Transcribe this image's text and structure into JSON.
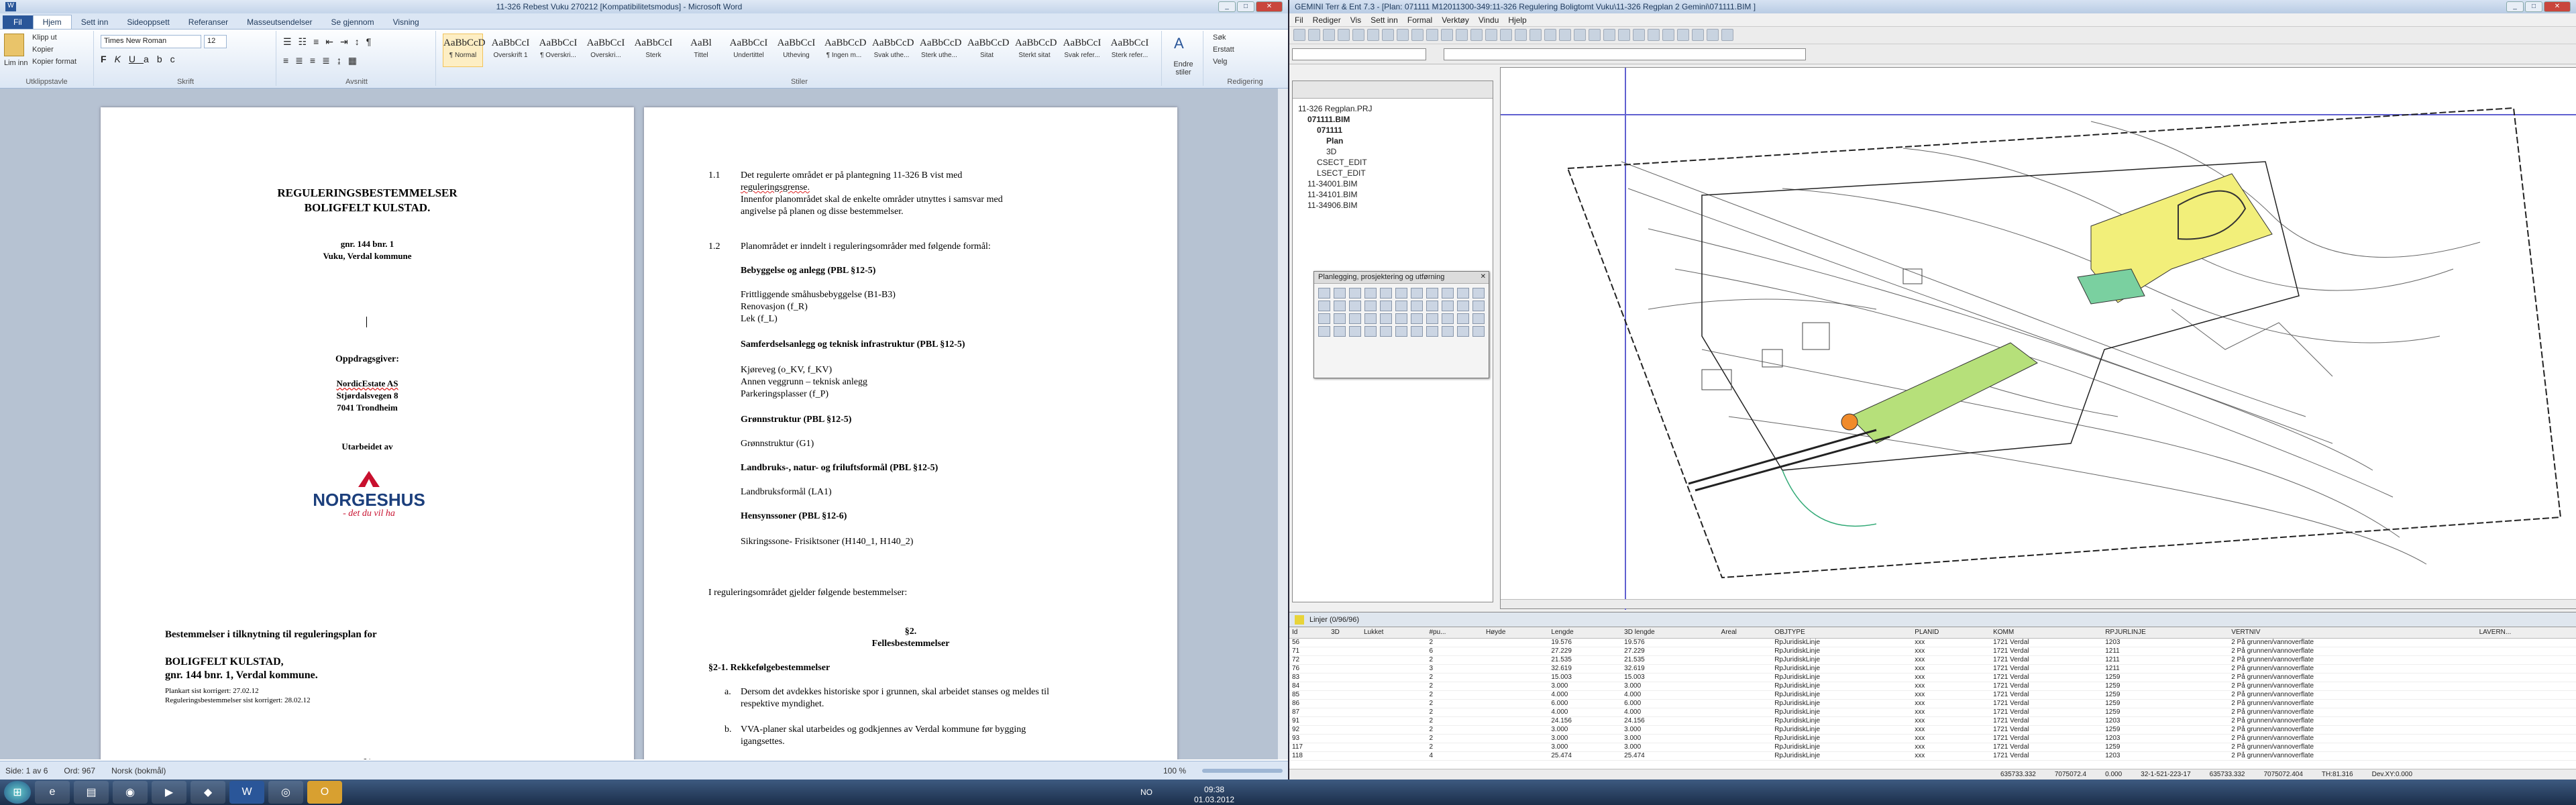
{
  "word": {
    "title": "11-326 Rebest Vuku 270212 [Kompatibilitetsmodus] - Microsoft Word",
    "tabs": [
      "Fil",
      "Hjem",
      "Sett inn",
      "Sideoppsett",
      "Referanser",
      "Masseutsendelser",
      "Se gjennom",
      "Visning"
    ],
    "clipboard": {
      "paste": "Lim inn",
      "cut": "Klipp ut",
      "copy": "Kopier",
      "format_painter": "Kopier format",
      "label": "Utklippstavle"
    },
    "font": {
      "name": "Times New Roman",
      "size": "12",
      "label": "Skrift"
    },
    "paragraph_label": "Avsnitt",
    "styles_label": "Stiler",
    "styles": [
      {
        "sample": "AaBbCcD",
        "name": "¶ Normal"
      },
      {
        "sample": "AaBbCcI",
        "name": "Overskrift 1"
      },
      {
        "sample": "AaBbCcI",
        "name": "¶ Overskri..."
      },
      {
        "sample": "AaBbCcI",
        "name": "Overskri..."
      },
      {
        "sample": "AaBbCcI",
        "name": "Sterk"
      },
      {
        "sample": "AaBl",
        "name": "Tittel"
      },
      {
        "sample": "AaBbCcI",
        "name": "Undertittel"
      },
      {
        "sample": "AaBbCcI",
        "name": "Utheving"
      },
      {
        "sample": "AaBbCcD",
        "name": "¶ Ingen m..."
      },
      {
        "sample": "AaBbCcD",
        "name": "Svak uthe..."
      },
      {
        "sample": "AaBbCcD",
        "name": "Sterk uthe..."
      },
      {
        "sample": "AaBbCcD",
        "name": "Sitat"
      },
      {
        "sample": "AaBbCcD",
        "name": "Sterkt sitat"
      },
      {
        "sample": "AaBbCcI",
        "name": "Svak refer..."
      },
      {
        "sample": "AaBbCcI",
        "name": "Sterk refer..."
      }
    ],
    "change_styles": "Endre stiler",
    "editing": {
      "find": "Søk",
      "replace": "Erstatt",
      "select": "Velg",
      "label": "Redigering"
    },
    "page1": {
      "title1": "REGULERINGSBESTEMMELSER",
      "title2": "BOLIGFELT KULSTAD.",
      "gnr": "gnr. 144 bnr. 1",
      "loc": "Vuku, Verdal kommune",
      "client_label": "Oppdragsgiver:",
      "client1": "NordicEstate AS",
      "client2": "Stjørdalsvegen 8",
      "client3": "7041 Trondheim",
      "made_by": "Utarbeidet av",
      "logo_text": "NORGESHUS",
      "logo_tag": "- det du vil ha",
      "b1": "Bestemmelser i tilknytning til reguleringsplan for",
      "b2": "BOLIGFELT KULSTAD,",
      "b3": "gnr. 144 bnr. 1, Verdal kommune.",
      "d1": "Plankart sist korrigert:  27.02.12",
      "d2": "Reguleringsbestemmelser sist korrigert:  28.02.12",
      "footer": "§1"
    },
    "page2": {
      "n11": "1.1",
      "l1": "Det regulerte området er på plantegning 11-326 B vist med",
      "l2": "reguleringsgrense.",
      "l3": "Innenfor planområdet skal de enkelte områder utnyttes i samsvar med",
      "l4": "angivelse på planen og disse bestemmelser.",
      "n12": "1.2",
      "l5": "Planområdet er inndelt i reguleringsområder med følgende formål:",
      "h1": "Bebyggelse og anlegg (PBL §12-5)",
      "l6": "Frittliggende småhusbebyggelse (B1-B3)",
      "l7": "Renovasjon (f_R)",
      "l8": "Lek (f_L)",
      "h2": "Samferdselsanlegg og teknisk infrastruktur (PBL §12-5)",
      "l9": "Kjøreveg (o_KV, f_KV)",
      "l10": "Annen veggrunn – teknisk anlegg",
      "l11": "Parkeringsplasser (f_P)",
      "h3": "Grønnstruktur (PBL §12-5)",
      "l12": "Grønnstruktur (G1)",
      "h4": "Landbruks-, natur- og friluftsformål (PBL §12-5)",
      "l13": "Landbruksformål (LA1)",
      "h5": "Hensynssoner (PBL §12-6)",
      "l14": "Sikringssone- Frisiktsoner (H140_1, H140_2)",
      "l15": "I reguleringsområdet gjelder følgende bestemmelser:",
      "p2": "§2.",
      "fb": "Fellesbestemmelser",
      "s21": "§2-1. Rekkefølgebestemmelser",
      "a": "a.",
      "la1": "Dersom det avdekkes historiske spor i grunnen, skal arbeidet stanses og meldes til",
      "la2": "respektive myndighet.",
      "b": "b.",
      "lb1": "VVA-planer skal utarbeides og godkjennes av Verdal kommune før bygging",
      "lb2": "igangsettes."
    },
    "status": {
      "page": "Side: 1 av 6",
      "words": "Ord: 967",
      "lang": "Norsk (bokmål)",
      "zoom": "100 %"
    }
  },
  "gemini": {
    "title": "GEMINI Terr & Ent 7.3 - [Plan: 071111  M12011300-349:11-326 Regulering Boligtomt Vuku\\11-326 Regplan 2 Gemini\\071111.BIM ]",
    "menu": [
      "Fil",
      "Rediger",
      "Vis",
      "Sett inn",
      "Formal",
      "Verktøy",
      "Vindu",
      "Hjelp"
    ],
    "tree": [
      {
        "text": "11-326 Regplan.PRJ",
        "indent": 0,
        "bold": false
      },
      {
        "text": "071111.BIM",
        "indent": 1,
        "bold": true
      },
      {
        "text": "071111",
        "indent": 2,
        "bold": true
      },
      {
        "text": "Plan",
        "indent": 3,
        "bold": true
      },
      {
        "text": "3D",
        "indent": 3,
        "bold": false
      },
      {
        "text": "CSECT_EDIT",
        "indent": 2,
        "bold": false
      },
      {
        "text": "LSECT_EDIT",
        "indent": 2,
        "bold": false
      },
      {
        "text": "11-34001.BIM",
        "indent": 1,
        "bold": false
      },
      {
        "text": "11-34101.BIM",
        "indent": 1,
        "bold": false
      },
      {
        "text": "11-34906.BIM",
        "indent": 1,
        "bold": false
      }
    ],
    "palette_title": "Planlegging, prosjektering og utførning",
    "table_title": "Linjer (0/96/96)",
    "columns": [
      "Id",
      "3D",
      "Lukket",
      "#pu...",
      "Høyde",
      "Lengde",
      "3D lengde",
      "Areal",
      "OBJTYPE",
      "PLANID",
      "KOMM",
      "RPJURLINJE",
      "VERTNIV",
      "LAVERN..."
    ],
    "rows": [
      [
        "56",
        "",
        "",
        "2",
        "",
        "19.576",
        "19.576",
        "",
        "RpJuridiskLinje",
        "xxx",
        "1721 Verdal",
        "1203",
        "2 På grunnen/vannoverflate",
        ""
      ],
      [
        "71",
        "",
        "",
        "6",
        "",
        "27.229",
        "27.229",
        "",
        "RpJuridiskLinje",
        "xxx",
        "1721 Verdal",
        "1211",
        "2 På grunnen/vannoverflate",
        ""
      ],
      [
        "72",
        "",
        "",
        "2",
        "",
        "21.535",
        "21.535",
        "",
        "RpJuridiskLinje",
        "xxx",
        "1721 Verdal",
        "1211",
        "2 På grunnen/vannoverflate",
        ""
      ],
      [
        "76",
        "",
        "",
        "3",
        "",
        "32.619",
        "32.619",
        "",
        "RpJuridiskLinje",
        "xxx",
        "1721 Verdal",
        "1211",
        "2 På grunnen/vannoverflate",
        ""
      ],
      [
        "83",
        "",
        "",
        "2",
        "",
        "15.003",
        "15.003",
        "",
        "RpJuridiskLinje",
        "xxx",
        "1721 Verdal",
        "1259",
        "2 På grunnen/vannoverflate",
        ""
      ],
      [
        "84",
        "",
        "",
        "2",
        "",
        "3.000",
        "3.000",
        "",
        "RpJuridiskLinje",
        "xxx",
        "1721 Verdal",
        "1259",
        "2 På grunnen/vannoverflate",
        ""
      ],
      [
        "85",
        "",
        "",
        "2",
        "",
        "4.000",
        "4.000",
        "",
        "RpJuridiskLinje",
        "xxx",
        "1721 Verdal",
        "1259",
        "2 På grunnen/vannoverflate",
        ""
      ],
      [
        "86",
        "",
        "",
        "2",
        "",
        "6.000",
        "6.000",
        "",
        "RpJuridiskLinje",
        "xxx",
        "1721 Verdal",
        "1259",
        "2 På grunnen/vannoverflate",
        ""
      ],
      [
        "87",
        "",
        "",
        "2",
        "",
        "4.000",
        "4.000",
        "",
        "RpJuridiskLinje",
        "xxx",
        "1721 Verdal",
        "1259",
        "2 På grunnen/vannoverflate",
        ""
      ],
      [
        "91",
        "",
        "",
        "2",
        "",
        "24.156",
        "24.156",
        "",
        "RpJuridiskLinje",
        "xxx",
        "1721 Verdal",
        "1203",
        "2 På grunnen/vannoverflate",
        ""
      ],
      [
        "92",
        "",
        "",
        "2",
        "",
        "3.000",
        "3.000",
        "",
        "RpJuridiskLinje",
        "xxx",
        "1721 Verdal",
        "1259",
        "2 På grunnen/vannoverflate",
        ""
      ],
      [
        "93",
        "",
        "",
        "2",
        "",
        "3.000",
        "3.000",
        "",
        "RpJuridiskLinje",
        "xxx",
        "1721 Verdal",
        "1203",
        "2 På grunnen/vannoverflate",
        ""
      ],
      [
        "117",
        "",
        "",
        "2",
        "",
        "3.000",
        "3.000",
        "",
        "RpJuridiskLinje",
        "xxx",
        "1721 Verdal",
        "1259",
        "2 På grunnen/vannoverflate",
        ""
      ],
      [
        "118",
        "",
        "",
        "4",
        "",
        "25.474",
        "25.474",
        "",
        "RpJuridiskLinje",
        "xxx",
        "1721 Verdal",
        "1203",
        "2 På grunnen/vannoverflate",
        ""
      ]
    ],
    "status": [
      "635733.332",
      "7075072.4",
      "0.000",
      "32-1-521-223-17",
      "635733.332",
      "7075072.404",
      "TH:81.316",
      "Dev.XY:0.000"
    ]
  },
  "taskbar": {
    "lang": "NO",
    "time": "09:38",
    "date": "01.03.2012"
  },
  "colors": {
    "word_blue": "#2a5699",
    "map_yellow": "#f2ef7a",
    "map_green": "#b6e07a"
  }
}
